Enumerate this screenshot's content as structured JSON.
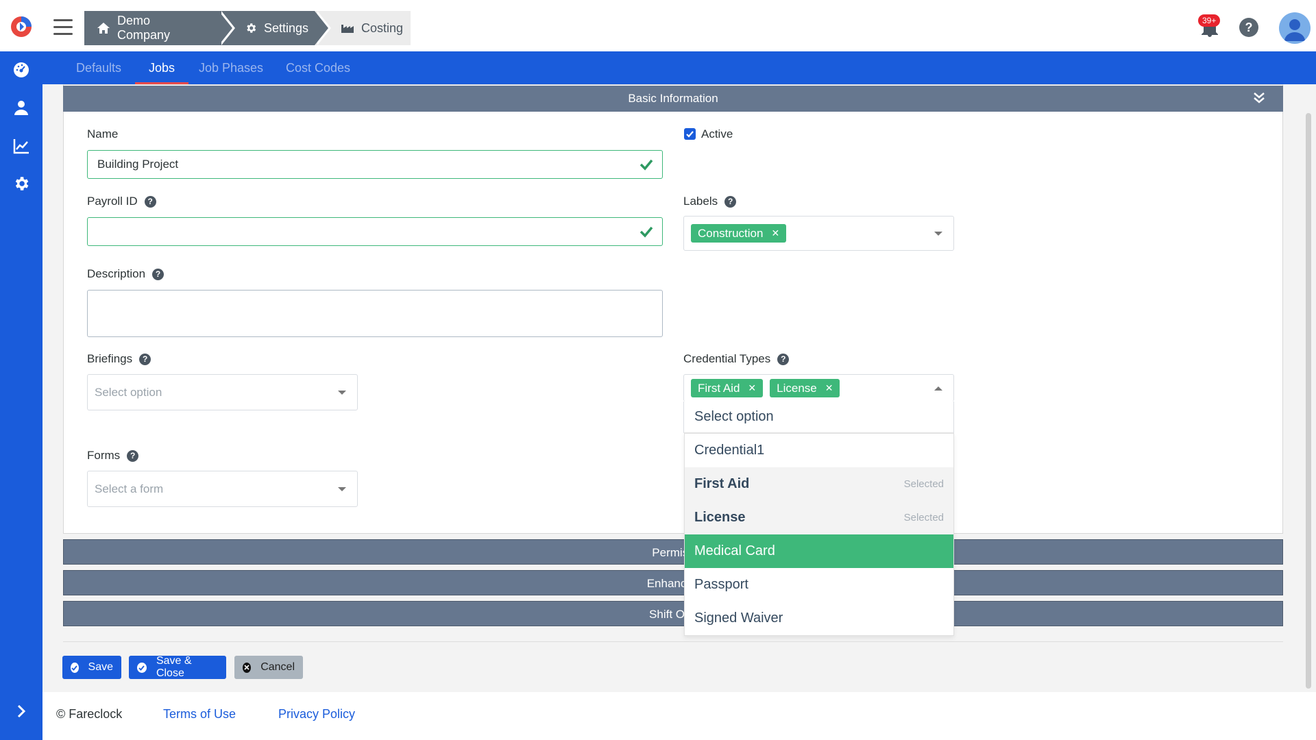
{
  "header": {
    "breadcrumb": [
      {
        "label": "Demo Company",
        "icon": "home-icon"
      },
      {
        "label": "Settings",
        "icon": "gear-icon"
      },
      {
        "label": "Costing",
        "icon": "factory-icon"
      }
    ],
    "notification_badge": "39+"
  },
  "tabs": [
    {
      "label": "Defaults",
      "active": false
    },
    {
      "label": "Jobs",
      "active": true
    },
    {
      "label": "Job Phases",
      "active": false
    },
    {
      "label": "Cost Codes",
      "active": false
    }
  ],
  "panel": {
    "title": "Basic Information"
  },
  "form": {
    "name_label": "Name",
    "name_value": "Building Project",
    "active_label": "Active",
    "active_checked": true,
    "payroll_label": "Payroll ID",
    "payroll_value": "",
    "labels_label": "Labels",
    "labels_tags": [
      "Construction"
    ],
    "description_label": "Description",
    "briefings_label": "Briefings",
    "briefings_placeholder": "Select option",
    "credential_label": "Credential Types",
    "credential_tags": [
      "First Aid",
      "License"
    ],
    "forms_label": "Forms",
    "forms_placeholder": "Select a form"
  },
  "dropdown": {
    "search_placeholder": "Select option",
    "selected_note": "Selected",
    "options": [
      {
        "label": "Credential1",
        "state": "normal"
      },
      {
        "label": "First Aid",
        "state": "selected"
      },
      {
        "label": "License",
        "state": "selected"
      },
      {
        "label": "Medical Card",
        "state": "highlighted"
      },
      {
        "label": "Passport",
        "state": "normal"
      },
      {
        "label": "Signed Waiver",
        "state": "normal"
      }
    ]
  },
  "sections": [
    {
      "label": "Permiss"
    },
    {
      "label": "Enhanced"
    },
    {
      "label": "Shift Ove"
    }
  ],
  "actions": {
    "save": "Save",
    "save_close": "Save & Close",
    "cancel": "Cancel"
  },
  "footer": {
    "copyright": "© Fareclock",
    "terms": "Terms of Use",
    "privacy": "Privacy Policy"
  },
  "colors": {
    "primary": "#1a5cdb",
    "success": "#3eb87a",
    "panel_header": "#66778f",
    "breadcrumb": "#616e7a"
  }
}
